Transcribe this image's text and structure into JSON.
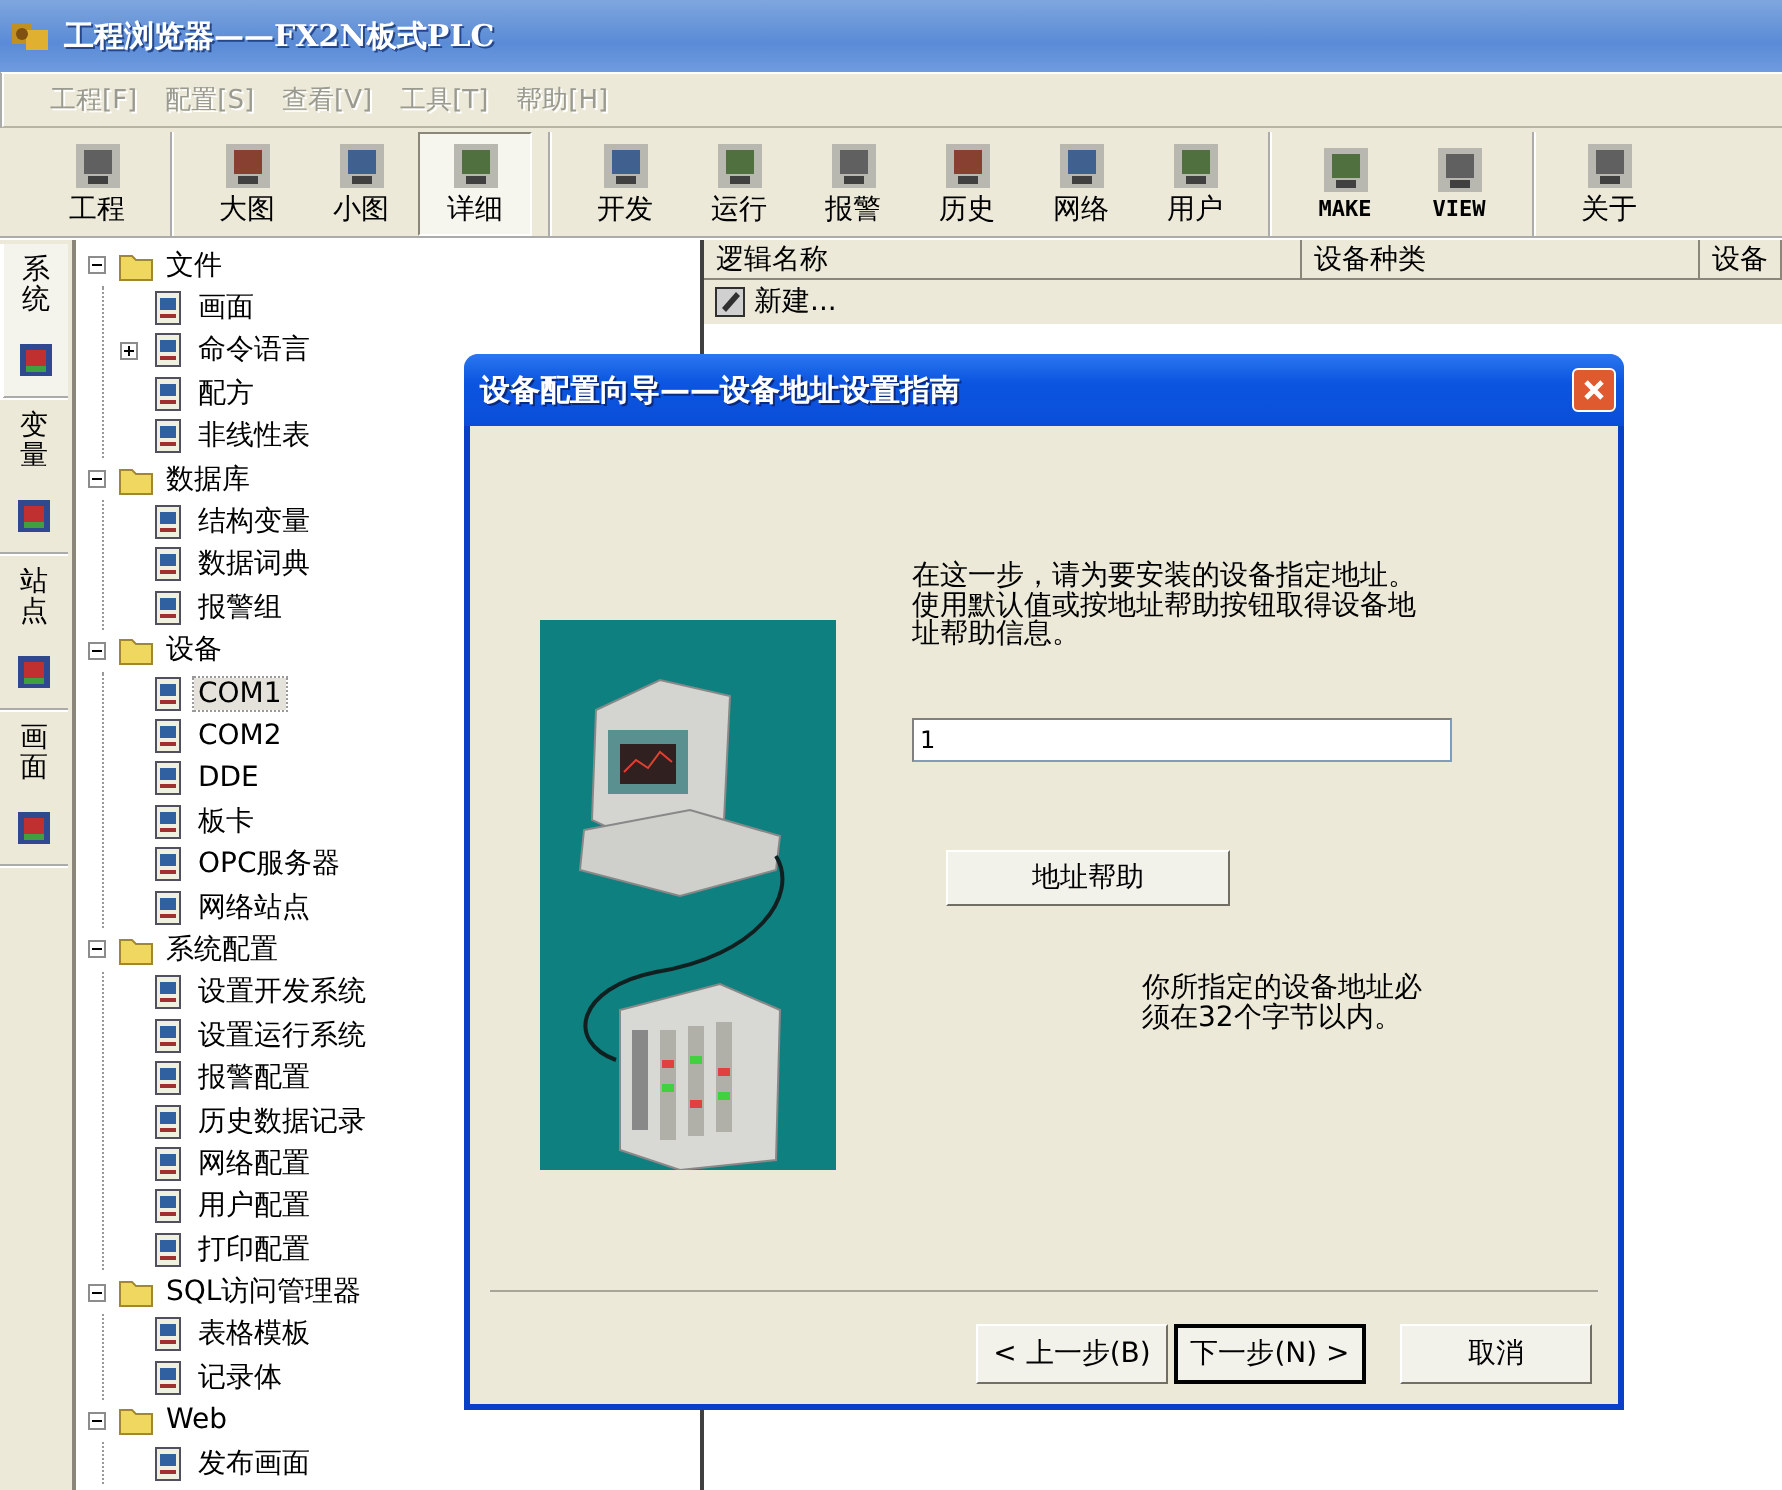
{
  "window": {
    "title": "工程浏览器——FX2N板式PLC"
  },
  "menu": [
    {
      "label": "工程[F]",
      "disabled": true
    },
    {
      "label": "配置[S]",
      "disabled": true
    },
    {
      "label": "查看[V]",
      "disabled": true
    },
    {
      "label": "工具[T]",
      "disabled": true
    },
    {
      "label": "帮助[H]",
      "disabled": true
    }
  ],
  "toolbar": [
    {
      "buttons": [
        {
          "label": "工程",
          "selected": false
        }
      ]
    },
    {
      "buttons": [
        {
          "label": "大图",
          "selected": false
        },
        {
          "label": "小图",
          "selected": false
        },
        {
          "label": "详细",
          "selected": true
        }
      ]
    },
    {
      "buttons": [
        {
          "label": "开发",
          "selected": false
        },
        {
          "label": "运行",
          "selected": false
        },
        {
          "label": "报警",
          "selected": false
        },
        {
          "label": "历史",
          "selected": false
        },
        {
          "label": "网络",
          "selected": false
        },
        {
          "label": "用户",
          "selected": false
        }
      ]
    },
    {
      "buttons": [
        {
          "label": "MAKE",
          "selected": false
        },
        {
          "label": "VIEW",
          "selected": false
        }
      ]
    },
    {
      "buttons": [
        {
          "label": "关于",
          "selected": false
        }
      ]
    }
  ],
  "side_tabs": [
    {
      "label": "系统",
      "selected": true
    },
    {
      "label": "变量",
      "selected": false
    },
    {
      "label": "站点",
      "selected": false
    },
    {
      "label": "画面",
      "selected": false
    }
  ],
  "tree": [
    {
      "label": "文件",
      "selected": false,
      "expanded": true,
      "children": [
        {
          "label": "画面",
          "selected": false
        },
        {
          "label": "命令语言",
          "selected": false,
          "expanded": false
        },
        {
          "label": "配方",
          "selected": false
        },
        {
          "label": "非线性表",
          "selected": false
        }
      ]
    },
    {
      "label": "数据库",
      "selected": false,
      "expanded": true,
      "children": [
        {
          "label": "结构变量",
          "selected": false
        },
        {
          "label": "数据词典",
          "selected": false
        },
        {
          "label": "报警组",
          "selected": false
        }
      ]
    },
    {
      "label": "设备",
      "selected": false,
      "expanded": true,
      "children": [
        {
          "label": "COM1",
          "selected": true
        },
        {
          "label": "COM2",
          "selected": false
        },
        {
          "label": "DDE",
          "selected": false
        },
        {
          "label": "板卡",
          "selected": false
        },
        {
          "label": "OPC服务器",
          "selected": false
        },
        {
          "label": "网络站点",
          "selected": false
        }
      ]
    },
    {
      "label": "系统配置",
      "selected": false,
      "expanded": true,
      "children": [
        {
          "label": "设置开发系统",
          "selected": false
        },
        {
          "label": "设置运行系统",
          "selected": false
        },
        {
          "label": "报警配置",
          "selected": false
        },
        {
          "label": "历史数据记录",
          "selected": false
        },
        {
          "label": "网络配置",
          "selected": false
        },
        {
          "label": "用户配置",
          "selected": false
        },
        {
          "label": "打印配置",
          "selected": false
        }
      ]
    },
    {
      "label": "SQL访问管理器",
      "selected": false,
      "expanded": true,
      "children": [
        {
          "label": "表格模板",
          "selected": false
        },
        {
          "label": "记录体",
          "selected": false
        }
      ]
    },
    {
      "label": "Web",
      "selected": false,
      "expanded": true,
      "children": [
        {
          "label": "发布画面",
          "selected": false
        }
      ]
    }
  ],
  "list": {
    "columns": [
      "逻辑名称",
      "设备种类",
      "设备"
    ],
    "rows": [
      {
        "name": "新建..."
      }
    ]
  },
  "dialog": {
    "title": "设备配置向导——设备地址设置指南",
    "instructions": "在这一步，请为要安装的设备指定地址。使用默认值或按地址帮助按钮取得设备地址帮助信息。",
    "address_field": {
      "value": "1"
    },
    "help_button": "地址帮助",
    "note": "你所指定的设备地址必须在32个字节以内。",
    "buttons": [
      {
        "label": "< 上一步(B)",
        "default": false
      },
      {
        "label": "下一步(N) >",
        "default": true
      },
      {
        "label": "取消",
        "default": false
      }
    ]
  }
}
